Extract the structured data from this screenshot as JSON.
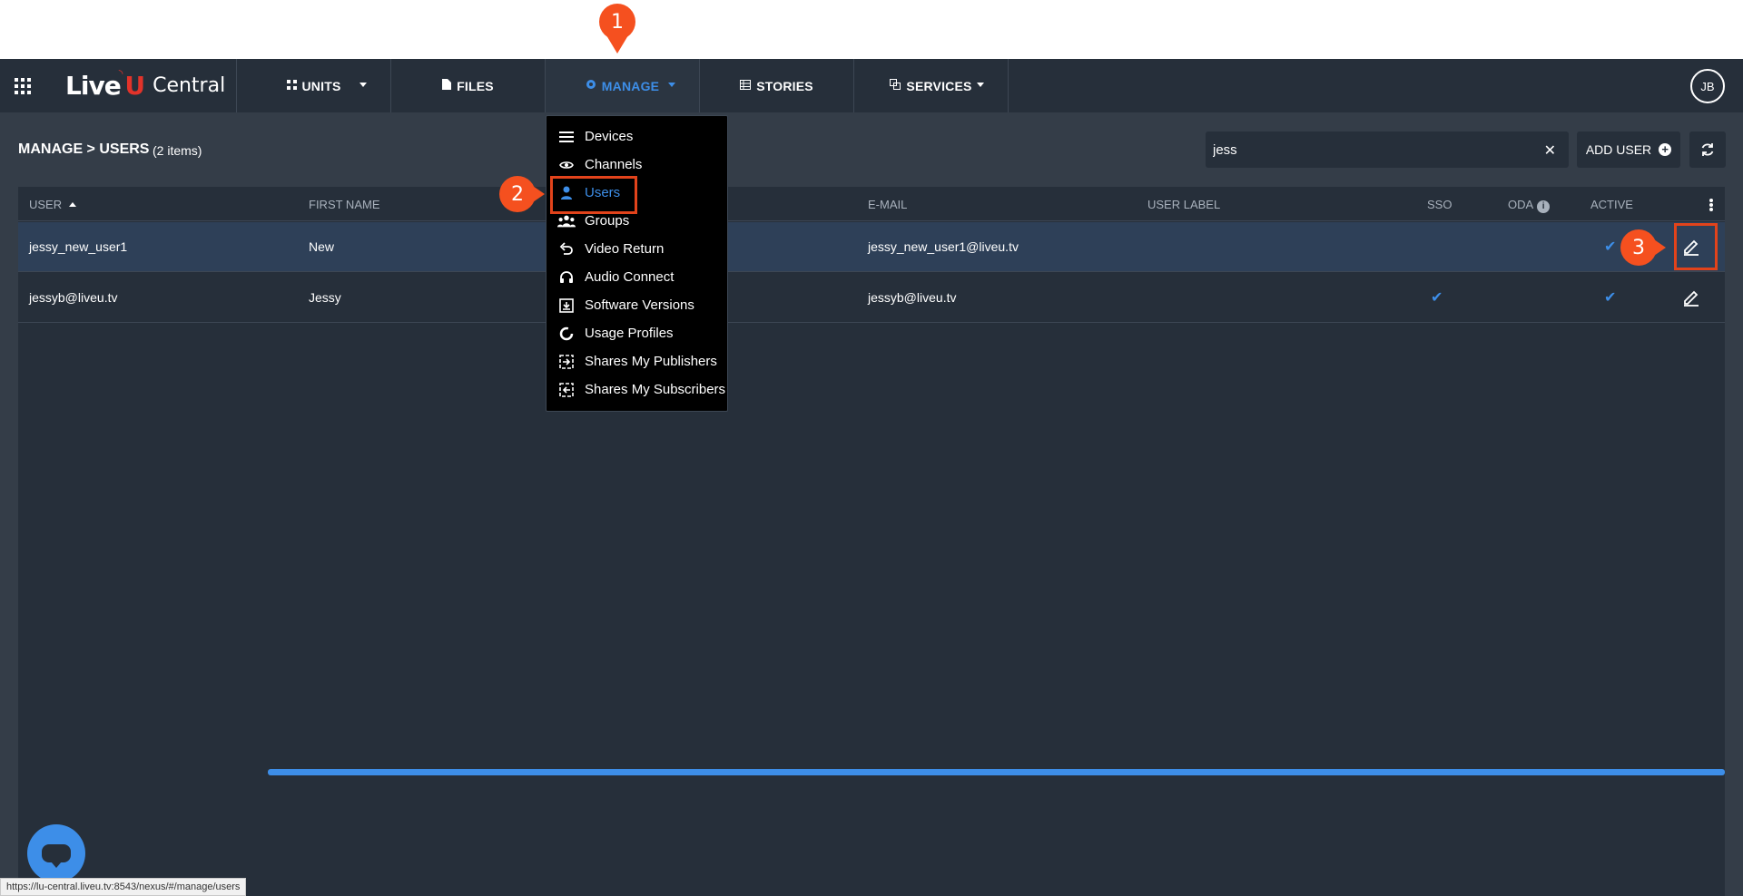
{
  "app": {
    "logo_live": "Live",
    "logo_u": "U",
    "logo_central": "Central",
    "user_initials": "JB"
  },
  "nav": {
    "tabs": [
      {
        "label": "UNITS",
        "icon": "grid-icon",
        "has_caret": true
      },
      {
        "label": "FILES",
        "icon": "file-icon",
        "has_caret": false
      },
      {
        "label": "MANAGE",
        "icon": "gear-icon",
        "has_caret": true,
        "active": true
      },
      {
        "label": "STORIES",
        "icon": "table-icon",
        "has_caret": false
      },
      {
        "label": "SERVICES",
        "icon": "services-icon",
        "has_caret": true
      }
    ]
  },
  "page": {
    "title": "MANAGE > USERS",
    "count": "(2 items)"
  },
  "search": {
    "value": "jess",
    "clear_label": "✕"
  },
  "toolbar": {
    "add_user_label": "ADD USER",
    "refresh_icon": "refresh-icon"
  },
  "table": {
    "columns": [
      "USER",
      "FIRST NAME",
      "E-MAIL",
      "USER LABEL",
      "SSO",
      "ODA",
      "ACTIVE"
    ],
    "rows": [
      {
        "user": "jessy_new_user1",
        "first_name": "New",
        "email": "jessy_new_user1@liveu.tv",
        "user_label": "",
        "sso": false,
        "active": true,
        "selected": true
      },
      {
        "user": "jessyb@liveu.tv",
        "first_name": "Jessy",
        "email": "jessyb@liveu.tv",
        "user_label": "",
        "sso": true,
        "active": true,
        "selected": false
      }
    ]
  },
  "manage_menu": {
    "items": [
      {
        "label": "Devices",
        "icon": "list-icon"
      },
      {
        "label": "Channels",
        "icon": "eye-icon"
      },
      {
        "label": "Users",
        "icon": "user-icon",
        "active": true
      },
      {
        "label": "Groups",
        "icon": "group-icon"
      },
      {
        "label": "Video Return",
        "icon": "return-icon"
      },
      {
        "label": "Audio Connect",
        "icon": "headset-icon"
      },
      {
        "label": "Software Versions",
        "icon": "download-icon"
      },
      {
        "label": "Usage Profiles",
        "icon": "circle-icon"
      },
      {
        "label": "Shares My Publishers",
        "icon": "share-publish-icon"
      },
      {
        "label": "Shares My Subscribers",
        "icon": "share-subscribe-icon"
      }
    ]
  },
  "callouts": [
    "1",
    "2",
    "3"
  ],
  "status_bar": {
    "url": "https://lu-central.liveu.tv:8543/nexus/#/manage/users"
  },
  "colors": {
    "accent": "#3d8ee8",
    "brand_red": "#e2332a",
    "callout": "#f5501f",
    "navbar": "#262f3a",
    "content_bg": "#343d48"
  }
}
